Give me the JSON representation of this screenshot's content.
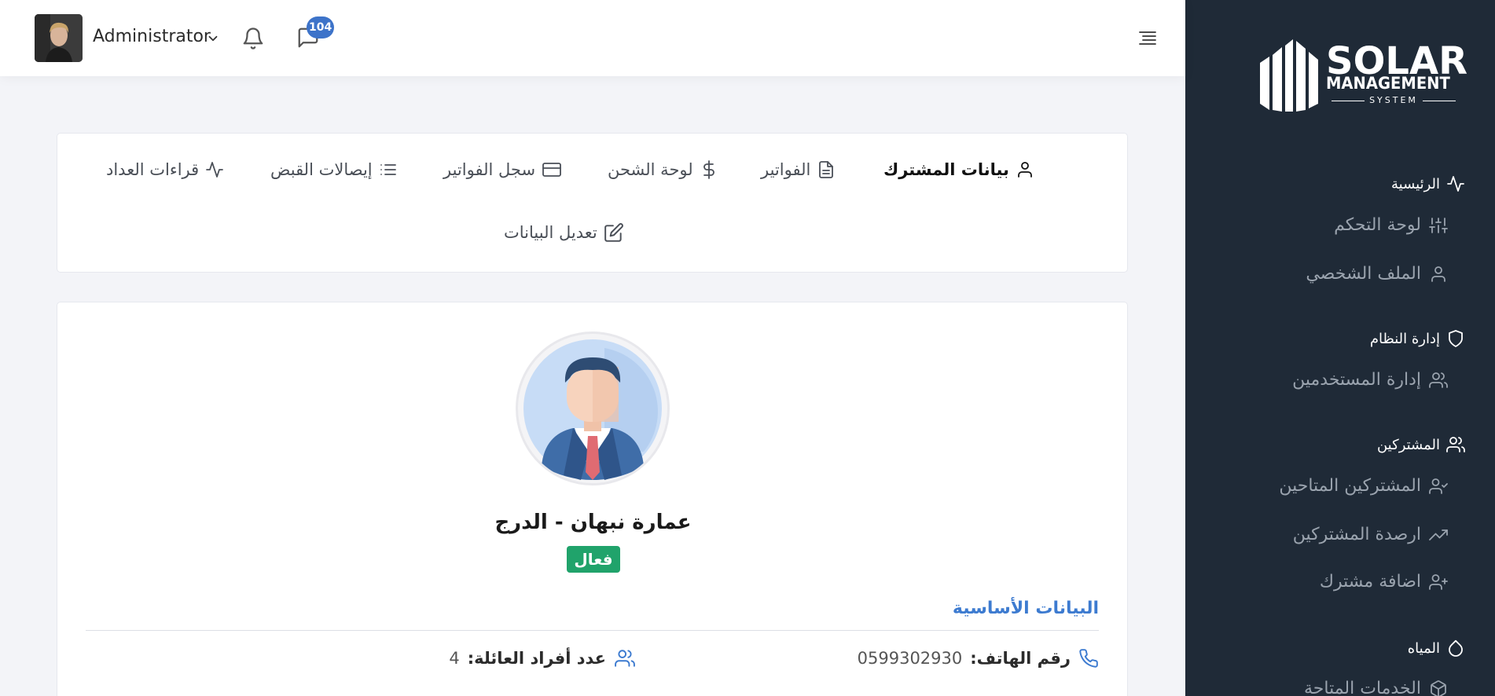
{
  "sidebar": {
    "logo": {
      "word1": "SOLAR",
      "word2": "MANAGEMENT",
      "word3": "SYSTEM"
    },
    "sections": [
      {
        "label": "الرئيسية",
        "icon": "activity-icon"
      },
      {
        "label": "إدارة النظام",
        "icon": "shield-icon"
      },
      {
        "label": "المشتركين",
        "icon": "users-icon"
      },
      {
        "label": "المياه",
        "icon": "droplet-icon"
      }
    ],
    "items": [
      {
        "label": "لوحة التحكم",
        "icon": "sliders-icon"
      },
      {
        "label": "الملف الشخصي",
        "icon": "user-icon"
      },
      {
        "label": "إدارة المستخدمين",
        "icon": "users-icon"
      },
      {
        "label": "المشتركين المتاحين",
        "icon": "user-check-icon"
      },
      {
        "label": "ارصدة المشتركين",
        "icon": "trending-up-icon"
      },
      {
        "label": "اضافة مشترك",
        "icon": "user-plus-icon"
      },
      {
        "label": "الخدمات المتاحة",
        "icon": "package-icon"
      }
    ]
  },
  "header": {
    "user_name": "Administrator",
    "messages_count": "104"
  },
  "tabs": [
    {
      "label": "بيانات المشترك",
      "icon": "user-icon",
      "active": true
    },
    {
      "label": "الفواتير",
      "icon": "file-text-icon",
      "active": false
    },
    {
      "label": "لوحة الشحن",
      "icon": "dollar-icon",
      "active": false
    },
    {
      "label": "سجل الفواتير",
      "icon": "credit-card-icon",
      "active": false
    },
    {
      "label": "إيصالات القبض",
      "icon": "list-icon",
      "active": false
    },
    {
      "label": "قراءات العداد",
      "icon": "activity-icon",
      "active": false
    },
    {
      "label": "تعديل البيانات",
      "icon": "edit-icon",
      "active": false
    }
  ],
  "subscriber": {
    "name": "عمارة نبهان - الدرج",
    "status": "فعال",
    "section_title": "البيانات الأساسية",
    "phone_label": "رقم الهاتف:",
    "phone_value": "0599302930",
    "family_label": "عدد أفراد العائلة:",
    "family_value": "4"
  },
  "colors": {
    "sidebar_bg": "#1f2a37",
    "accent": "#3d7bd0",
    "status_active": "#20a36b",
    "badge": "#3d73c9"
  }
}
